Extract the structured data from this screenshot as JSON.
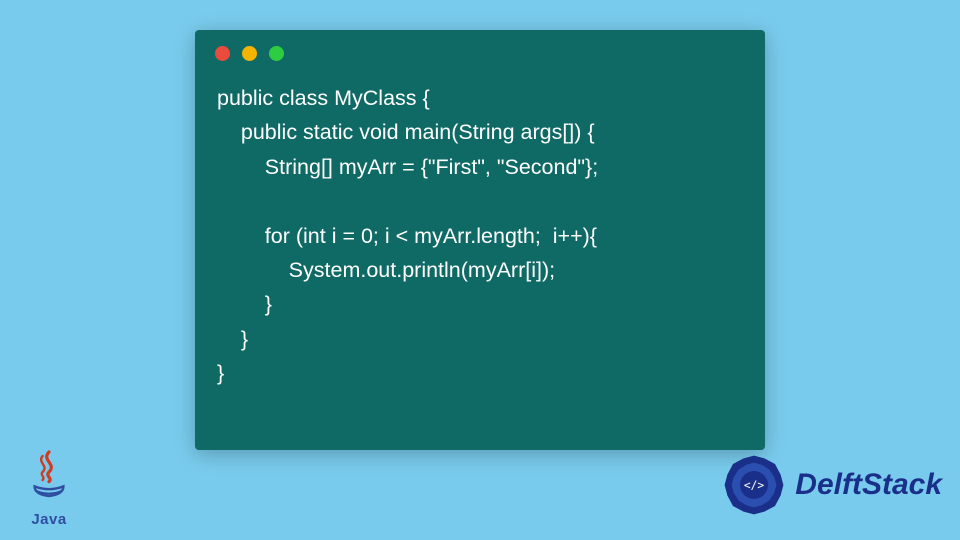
{
  "code": {
    "line1": "public class MyClass {",
    "line2": "    public static void main(String args[]) {",
    "line3": "        String[] myArr = {\"First\", \"Second\"};",
    "line4": "",
    "line5": "        for (int i = 0; i < myArr.length;  i++){",
    "line6": "            System.out.println(myArr[i]);",
    "line7": "        }",
    "line8": "    }",
    "line9": "}"
  },
  "java_logo_label": "Java",
  "brand_text": "DelftStack",
  "colors": {
    "page_bg": "#79cbed",
    "window_bg": "#0f6a66",
    "code_text": "#ffffff",
    "dot_red": "#e94b3c",
    "dot_yellow": "#f4b400",
    "dot_green": "#2ecc40",
    "java_red": "#d13b1f",
    "java_blue": "#2f4ea1",
    "brand_blue": "#1a2f8a"
  }
}
